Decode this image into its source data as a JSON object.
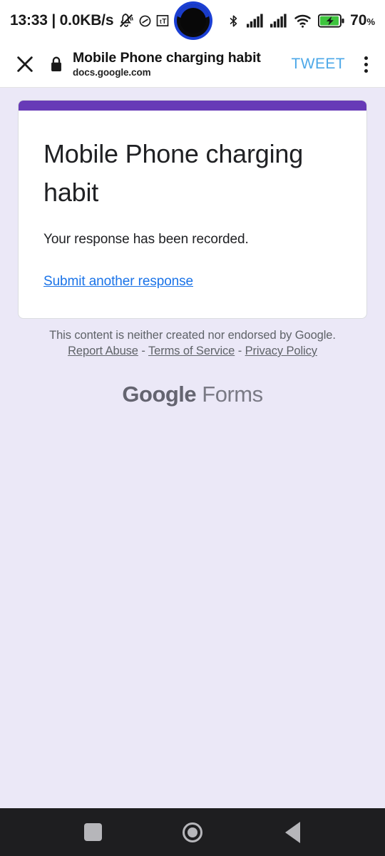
{
  "status_bar": {
    "clock": "13:33 | 0.0KB/s",
    "battery_percent": "70",
    "percent_sign": "%",
    "icons": [
      "notifications-muted-icon",
      "data-saver-icon",
      "text-size-icon",
      "bluetooth-icon",
      "signal-sim1-icon",
      "signal-sim2-icon",
      "wifi-icon",
      "battery-charging-icon"
    ]
  },
  "browser_bar": {
    "close_label": "✕",
    "page_title": "Mobile Phone charging habit",
    "url": "docs.google.com",
    "tweet_label": "TWEET",
    "secure_icon": "lock-icon",
    "overflow_icon": "more-vertical-icon"
  },
  "form": {
    "accent_color": "#673ab7",
    "heading": "Mobile Phone charging habit",
    "confirmation": "Your response has been recorded.",
    "submit_another_label": "Submit another response",
    "link_color": "#1a73e8"
  },
  "footer": {
    "disclaimer": "This content is neither created nor endorsed by Google.",
    "links": [
      {
        "label": "Report Abuse"
      },
      {
        "label": "Terms of Service"
      },
      {
        "label": "Privacy Policy"
      }
    ],
    "separator": " - ",
    "logo_primary": "Google",
    "logo_secondary": " Forms"
  },
  "nav_bar": {
    "recents_label": "recents",
    "home_label": "home",
    "back_label": "back"
  },
  "theme": {
    "page_background": "#ebe8f7",
    "card_background": "#ffffff",
    "nav_background": "#1e1e20",
    "tweet_blue": "#4da8e8"
  }
}
